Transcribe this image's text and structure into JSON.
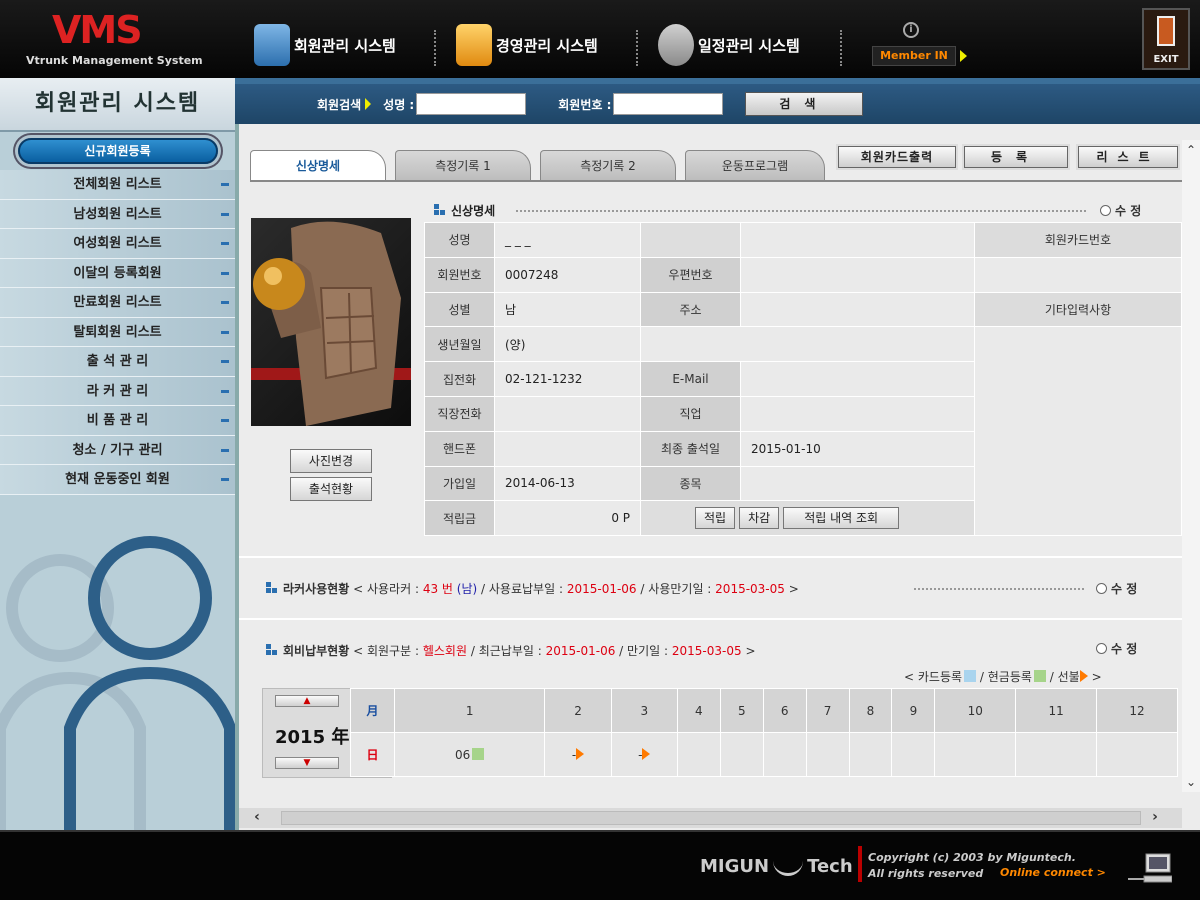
{
  "header": {
    "logo_mark": "VMS",
    "logo_sub": "Vtrunk Management System",
    "nav": [
      {
        "label": "회원관리 시스템"
      },
      {
        "label": "경영관리 시스템"
      },
      {
        "label": "일정관리 시스템"
      }
    ],
    "member_in": "Member IN",
    "info_glyph": "i",
    "exit_label": "EXIT"
  },
  "sidebar": {
    "title": "회원관리 시스템",
    "new_member": "신규회원등록",
    "items": [
      "전체회원 리스트",
      "남성회원 리스트",
      "여성회원 리스트",
      "이달의 등록회원",
      "만료회원 리스트",
      "탈퇴회원 리스트",
      "출 석 관 리",
      "라 커 관 리",
      "비 품 관 리",
      "청소 / 기구 관리",
      "현재 운동중인 회원"
    ]
  },
  "search": {
    "label": "회원검색",
    "name_label": "성명 :",
    "number_label": "회원번호 :",
    "name_value": "",
    "number_value": "",
    "button": "검색"
  },
  "tabs": [
    "신상명세",
    "측정기록 1",
    "측정기록 2",
    "운동프로그램"
  ],
  "actions": [
    "회원카드출력",
    "등록",
    "리스트"
  ],
  "profile": {
    "section_title": "신상명세",
    "edit": "수 정",
    "photo_change": "사진변경",
    "attendance_status": "출석현황",
    "fields": {
      "name_label": "성명",
      "name_value": "_ _ _",
      "id_label": "회원번호",
      "id_value": "0007248",
      "zip_label": "우편번호",
      "zip_value": "",
      "gender_label": "성별",
      "gender_value": "남",
      "address_label": "주소",
      "address_value": "",
      "birth_label": "생년월일",
      "birth_value": "(양)",
      "home_phone_label": "집전화",
      "home_phone_value": "02-121-1232",
      "email_label": "E-Mail",
      "email_value": "",
      "work_phone_label": "직장전화",
      "work_phone_value": "",
      "job_label": "직업",
      "job_value": "",
      "mobile_label": "핸드폰",
      "mobile_value": "",
      "last_attend_label": "최종 출석일",
      "last_attend_value": "2015-01-10",
      "join_label": "가입일",
      "join_value": "2014-06-13",
      "type_label": "종목",
      "type_value": "",
      "points_label": "적립금",
      "points_value": "0 P",
      "card_label": "회원카드번호",
      "etc_label": "기타입력사항"
    },
    "points_buttons": [
      "적립",
      "차감",
      "적립 내역 조회"
    ]
  },
  "locker": {
    "title": "라커사용현황",
    "open": "<",
    "label_locker": "사용라커 :",
    "locker_no": "43 번",
    "locker_sex": "(남)",
    "sep1": "/",
    "label_pay": "사용료납부일 :",
    "pay_date": "2015-01-06",
    "sep2": "/",
    "label_expire": "사용만기일 :",
    "expire_date": "2015-03-05",
    "close": ">",
    "edit": "수 정"
  },
  "fee": {
    "title": "회비납부현황",
    "open": "<",
    "label_type": "회원구분 :",
    "member_type": "헬스회원",
    "sep1": "/",
    "label_last": "최근납부일 :",
    "last_pay": "2015-01-06",
    "sep2": "/",
    "label_expire": "만기일 :",
    "expire_date": "2015-03-05",
    "close": ">",
    "edit": "수 정",
    "legend": {
      "open": "<",
      "card": "카드등록",
      "sep1": "/",
      "cash": "현금등록",
      "sep2": "/",
      "prepaid": "선불",
      "close": ">"
    },
    "colors": {
      "card": "#a9d4ee",
      "cash": "#a6d48a",
      "prepaid": "#ff7a00"
    }
  },
  "calendar": {
    "year": "2015 年",
    "year_up": "▲",
    "year_down": "▼",
    "month_header": "月",
    "day_header": "日",
    "months": [
      "1",
      "2",
      "3",
      "4",
      "5",
      "6",
      "7",
      "8",
      "9",
      "10",
      "11",
      "12"
    ],
    "days": [
      "06",
      "-",
      "-",
      "",
      "",
      "",
      "",
      "",
      "",
      "",
      "",
      ""
    ],
    "day_marks": [
      "cash",
      "prepaid",
      "prepaid",
      "",
      "",
      "",
      "",
      "",
      "",
      "",
      "",
      ""
    ]
  },
  "footer": {
    "brand_left": "MIGUN",
    "brand_right": "Tech",
    "copyright_line1": "Copyright (c) 2003 by Miguntech.",
    "copyright_line2": "All rights reserved",
    "online": "Online connect >"
  }
}
